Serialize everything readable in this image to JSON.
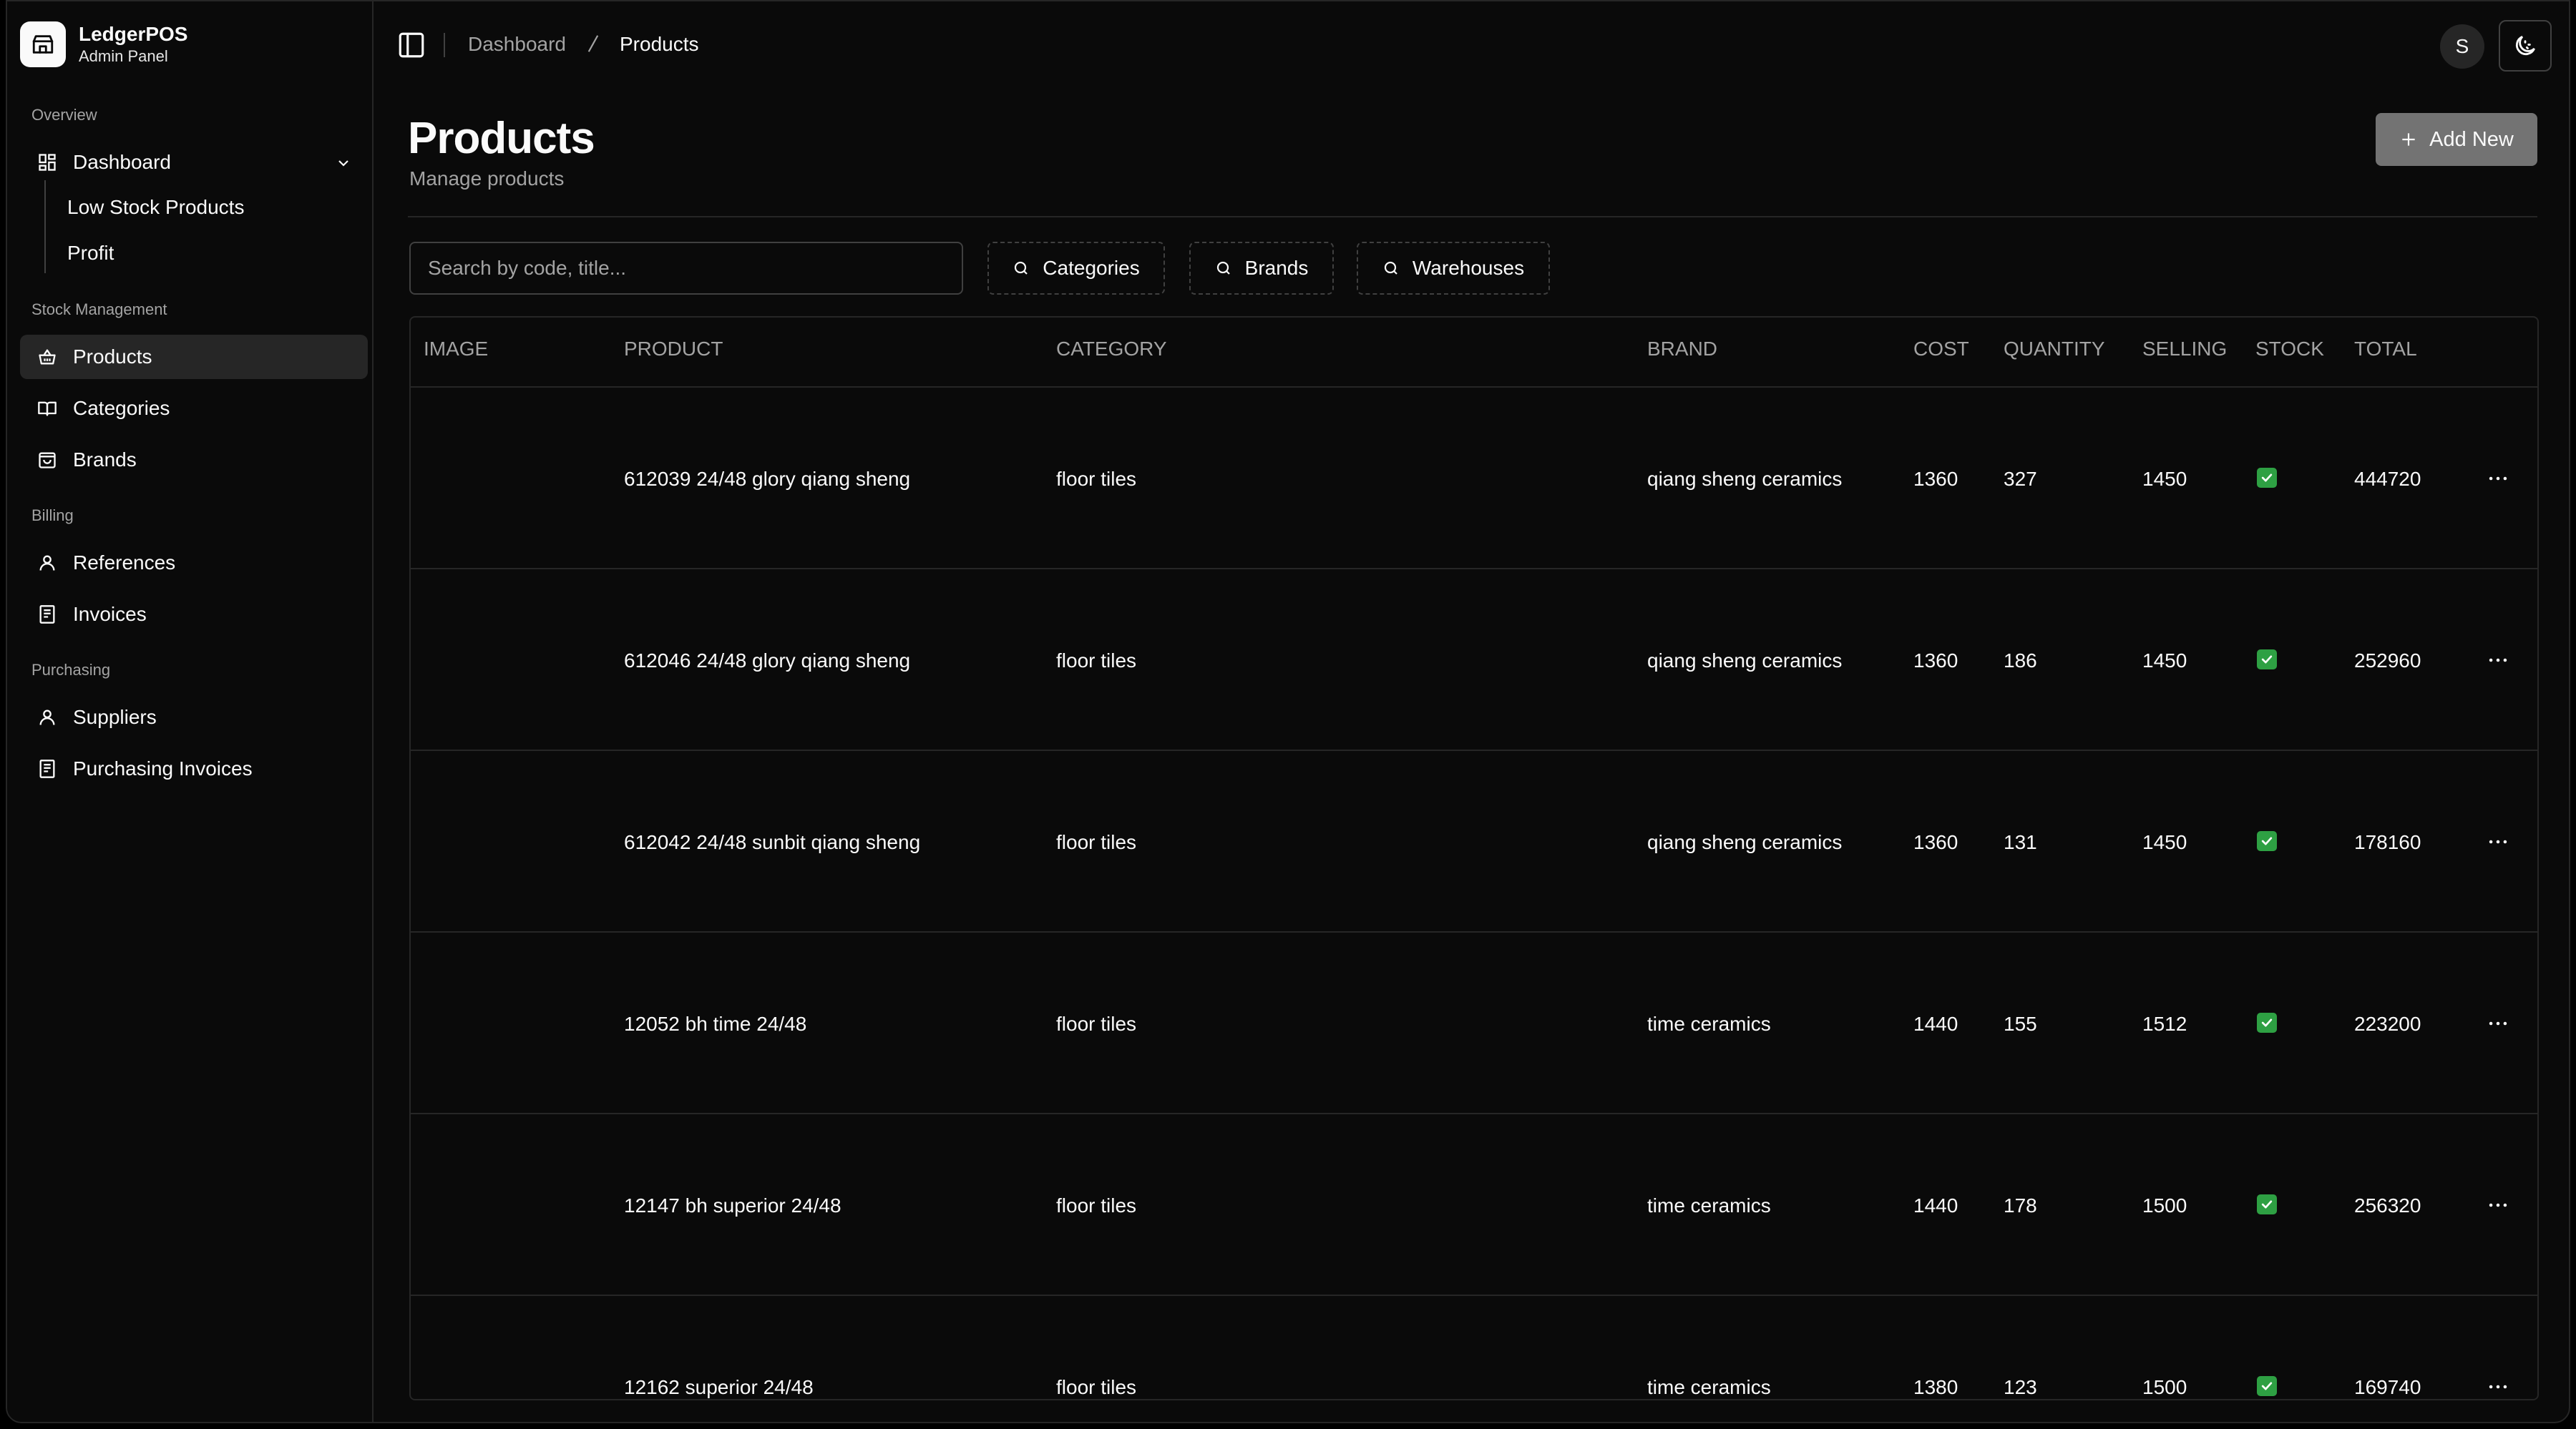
{
  "brand": {
    "name": "LedgerPOS",
    "subtitle": "Admin Panel"
  },
  "sidebar": {
    "groups": [
      {
        "label": "Overview"
      },
      {
        "label": "Stock Management"
      },
      {
        "label": "Billing"
      },
      {
        "label": "Purchasing"
      }
    ],
    "dashboard": {
      "label": "Dashboard",
      "children": [
        "Low Stock Products",
        "Profit"
      ]
    },
    "items": [
      {
        "label": "Products",
        "active": true
      },
      {
        "label": "Categories"
      },
      {
        "label": "Brands"
      },
      {
        "label": "References"
      },
      {
        "label": "Invoices"
      },
      {
        "label": "Suppliers"
      },
      {
        "label": "Purchasing Invoices"
      }
    ]
  },
  "breadcrumb": [
    "Dashboard",
    "Products"
  ],
  "user": {
    "initial": "S"
  },
  "page": {
    "title": "Products",
    "subtitle": "Manage products",
    "add_label": "Add New"
  },
  "search": {
    "placeholder": "Search by code, title..."
  },
  "filters": [
    "Categories",
    "Brands",
    "Warehouses"
  ],
  "table": {
    "columns": [
      "IMAGE",
      "PRODUCT",
      "CATEGORY",
      "BRAND",
      "COST",
      "QUANTITY",
      "SELLING",
      "STOCK",
      "TOTAL"
    ],
    "rows": [
      {
        "product": "612039 24/48 glory qiang sheng",
        "category": "floor tiles",
        "brand": "qiang sheng ceramics",
        "cost": "1360",
        "quantity": "327",
        "selling": "1450",
        "stock": true,
        "total": "444720"
      },
      {
        "product": "612046 24/48 glory qiang sheng",
        "category": "floor tiles",
        "brand": "qiang sheng ceramics",
        "cost": "1360",
        "quantity": "186",
        "selling": "1450",
        "stock": true,
        "total": "252960"
      },
      {
        "product": "612042 24/48 sunbit qiang sheng",
        "category": "floor tiles",
        "brand": "qiang sheng ceramics",
        "cost": "1360",
        "quantity": "131",
        "selling": "1450",
        "stock": true,
        "total": "178160"
      },
      {
        "product": "12052 bh time 24/48",
        "category": "floor tiles",
        "brand": "time ceramics",
        "cost": "1440",
        "quantity": "155",
        "selling": "1512",
        "stock": true,
        "total": "223200"
      },
      {
        "product": "12147 bh superior 24/48",
        "category": "floor tiles",
        "brand": "time ceramics",
        "cost": "1440",
        "quantity": "178",
        "selling": "1500",
        "stock": true,
        "total": "256320"
      },
      {
        "product": "12162 superior 24/48",
        "category": "floor tiles",
        "brand": "time ceramics",
        "cost": "1380",
        "quantity": "123",
        "selling": "1500",
        "stock": true,
        "total": "169740"
      }
    ]
  },
  "colors": {
    "background": "#0a0a0a",
    "border": "#262626",
    "muted_text": "#a3a3a3",
    "stock_ok": "#2ea043",
    "add_button": "#737373"
  }
}
